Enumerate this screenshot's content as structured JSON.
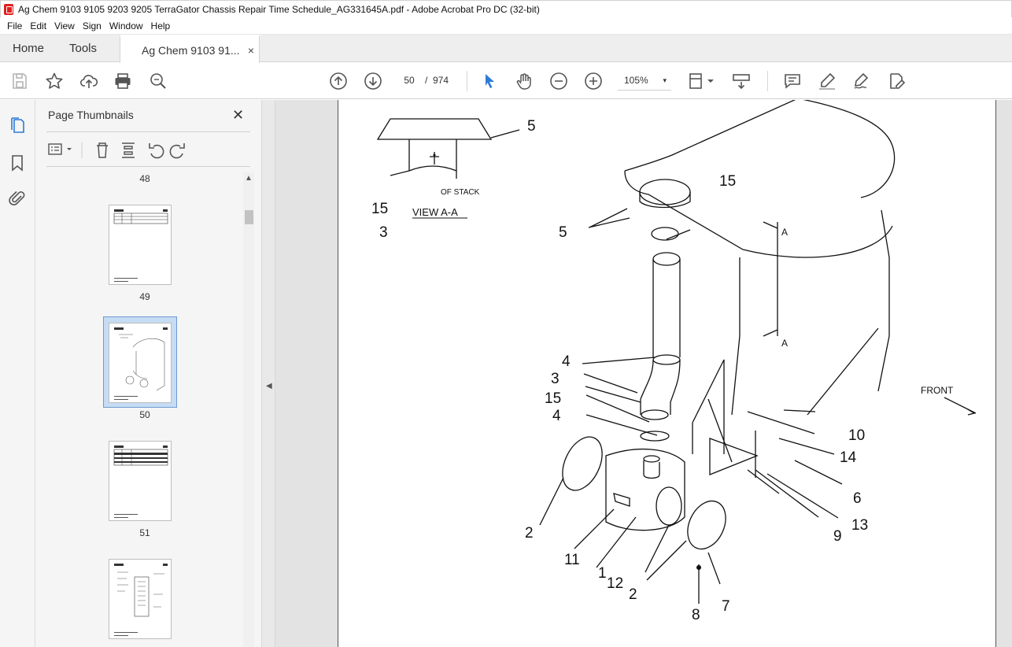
{
  "window": {
    "title": "Ag Chem 9103 9105 9203 9205 TerraGator Chassis Repair Time Schedule_AG331645A.pdf - Adobe Acrobat Pro DC (32-bit)"
  },
  "menu": {
    "items": [
      "File",
      "Edit",
      "View",
      "Sign",
      "Window",
      "Help"
    ]
  },
  "tabs": {
    "home": "Home",
    "tools": "Tools",
    "document": "Ag Chem 9103 91...",
    "close_glyph": "×"
  },
  "toolbar": {
    "current_page": "50",
    "page_separator": "/",
    "total_pages": "974",
    "zoom": "105%",
    "zoom_caret": "▾"
  },
  "panel": {
    "title": "Page Thumbnails",
    "close_glyph": "✕",
    "thumbnails": [
      {
        "label": "48"
      },
      {
        "label": "49"
      },
      {
        "label": "50",
        "selected": true
      },
      {
        "label": "51"
      }
    ],
    "scroll_up_glyph": "▲",
    "collapse_glyph": "◀"
  },
  "diagram": {
    "callouts": [
      "5",
      "15",
      "3",
      "5",
      "15",
      "4",
      "3",
      "15",
      "4",
      "10",
      "14",
      "6",
      "13",
      "9",
      "2",
      "11",
      "1",
      "12",
      "2",
      "7",
      "8"
    ],
    "view_label": "VIEW A-A",
    "stack_label": "OF STACK",
    "section_a_top": "A",
    "section_a_bottom": "A",
    "front_label": "FRONT"
  },
  "icons": {
    "save": "save-icon",
    "bookmark_star": "star-icon",
    "upload": "upload-icon",
    "print": "print-icon",
    "find": "zoom-search-icon",
    "prev": "arrow-up-circle-icon",
    "next": "arrow-down-circle-icon",
    "select": "cursor-icon",
    "hand": "hand-icon",
    "zoom_out": "zoom-out-icon",
    "zoom_in": "zoom-in-icon",
    "fit": "fit-page-icon",
    "scroll": "scroll-mode-icon",
    "comment": "comment-icon",
    "highlight": "highlight-icon",
    "sign": "sign-icon",
    "edit": "edit-pdf-icon"
  },
  "colors": {
    "accent": "#2d7bd5",
    "app_red": "#e02020",
    "selection": "#c6dcf3"
  }
}
